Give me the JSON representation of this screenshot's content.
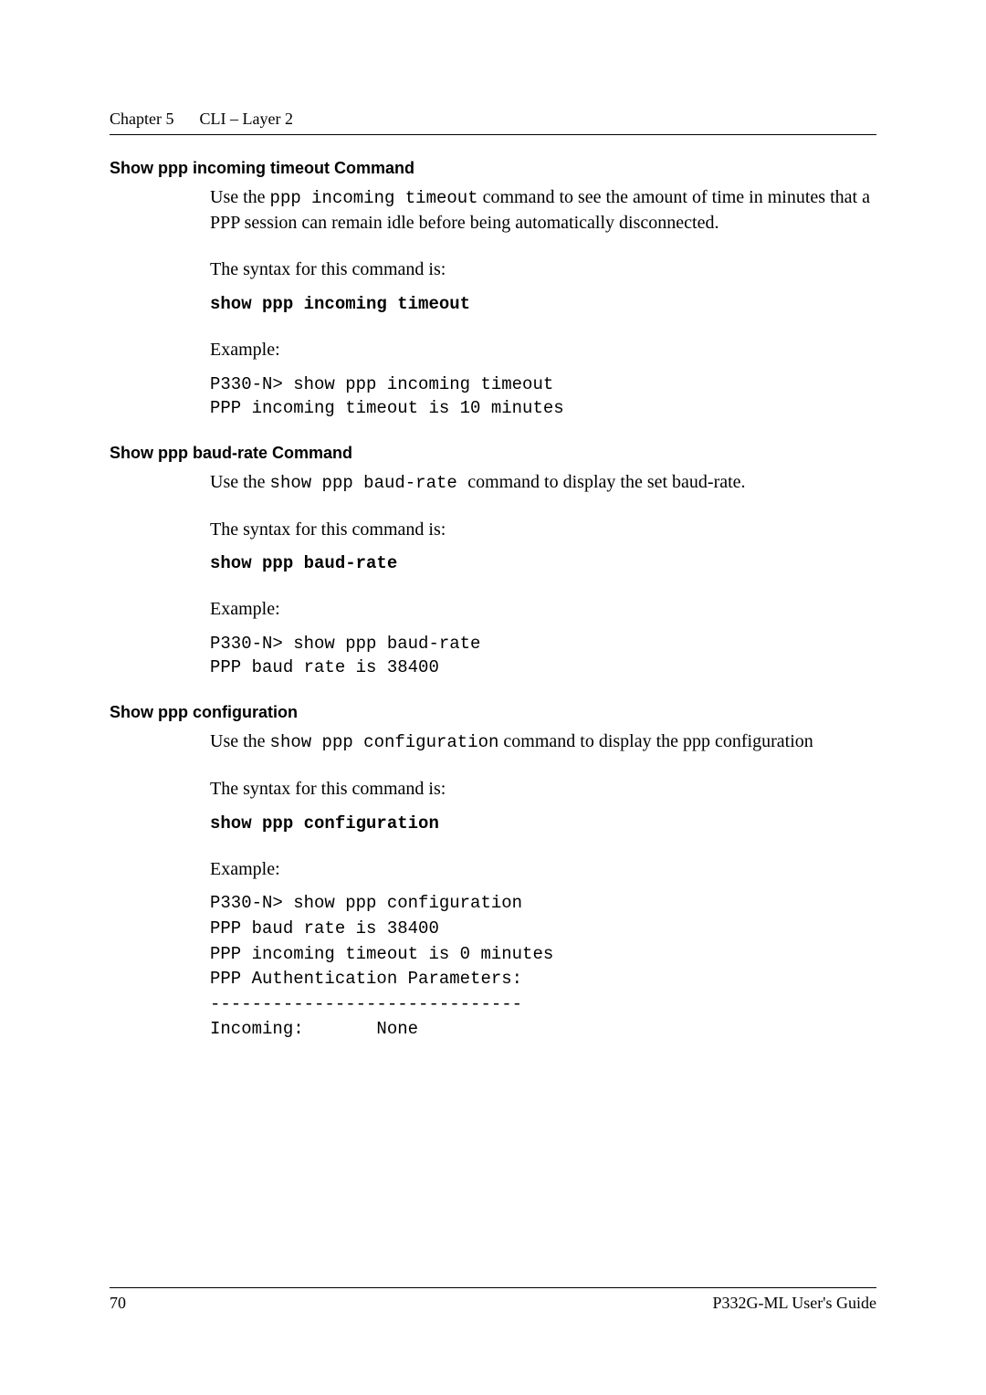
{
  "header": {
    "chapter": "Chapter 5",
    "title": "CLI – Layer 2"
  },
  "sections": {
    "s1": {
      "heading": "Show ppp incoming timeout Command",
      "intro_pre": "Use the ",
      "intro_cmd": "ppp incoming timeout",
      "intro_post": " command to see the amount of time in minutes that a PPP session can remain idle before being automatically disconnected.",
      "syntax_label": "The syntax for this command is:",
      "syntax_cmd": "show ppp incoming timeout",
      "example_label": "Example:",
      "example_line1": "P330-N> show ppp incoming timeout",
      "example_line2": "PPP incoming timeout is 10 minutes"
    },
    "s2": {
      "heading": "Show ppp baud-rate Command",
      "intro_pre": "Use the ",
      "intro_cmd": "show ppp baud-rate ",
      "intro_post": " command to display the set baud-rate.",
      "syntax_label": "The syntax for this command is:",
      "syntax_cmd": "show ppp baud-rate",
      "example_label": "Example:",
      "example_line1": "P330-N> show ppp baud-rate",
      "example_line2": "PPP baud rate is 38400"
    },
    "s3": {
      "heading": "Show ppp configuration",
      "intro_pre": "Use the ",
      "intro_cmd": "show ppp configuration",
      "intro_post": " command to display the ppp configuration",
      "syntax_label": "The syntax for this command is:",
      "syntax_cmd": "show ppp configuration",
      "example_label": "Example:",
      "example_block": "P330-N> show ppp configuration\nPPP baud rate is 38400\nPPP incoming timeout is 0 minutes\nPPP Authentication Parameters:\n------------------------------\nIncoming:       None"
    }
  },
  "footer": {
    "page_number": "70",
    "doc_title": "P332G-ML User's Guide"
  }
}
